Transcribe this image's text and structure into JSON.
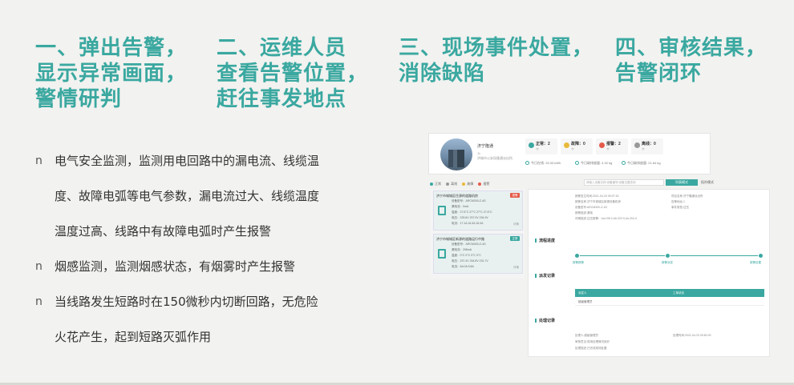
{
  "headings": [
    {
      "lines": [
        "一、弹出告警，",
        "显示异常画面，",
        "警情研判"
      ]
    },
    {
      "lines": [
        "二、运维人员",
        "查看告警位置，",
        "赶往事发地点"
      ]
    },
    {
      "lines": [
        "三、现场事件处置，",
        "消除缺陷"
      ]
    },
    {
      "lines": [
        "四、审核结果，",
        "告警闭环"
      ]
    }
  ],
  "bullet_mark": "n",
  "bullets": [
    {
      "lines": [
        "电气安全监测，监测用电回路中的漏电流、线缆温",
        "度、故障电弧等电气参数，漏电流过大、线缆温度",
        "温度过高、线路中有故障电弧时产生报警"
      ]
    },
    {
      "lines": [
        "烟感监测，监测烟感状态，有烟雾时产生报警"
      ]
    },
    {
      "lines": [
        "当线路发生短路时在150微秒内切断回路，无危险",
        "火花产生，起到短路灭弧作用"
      ]
    }
  ],
  "screenshot": {
    "place_name": "济宁隆通",
    "place_sub1": "11",
    "place_sub2": "济城市公安局隆通派出所",
    "stats": [
      {
        "label": "正常：2",
        "sub": "个",
        "color": "#3aa8a0"
      },
      {
        "label": "故障：0",
        "sub": "个",
        "color": "#e8b93a"
      },
      {
        "label": "报警：2",
        "sub": "个",
        "color": "#e55a4a"
      },
      {
        "label": "离线：0",
        "sub": "个",
        "color": "#999999"
      }
    ],
    "metrics": [
      "今日在线: 33.33 kWh",
      "今日碳排放量: 4.32 kg",
      "今日碳排放量: 21.64 kg"
    ],
    "legend": [
      {
        "label": "正常",
        "color": "#3aa8a0"
      },
      {
        "label": "离线",
        "color": "#999999"
      },
      {
        "label": "故障",
        "color": "#e8b93a"
      },
      {
        "label": "报警",
        "color": "#e55a4a"
      }
    ],
    "search_placeholder": "请输入设备名称/设备编号/设备位置查询",
    "list_btn": "列表模式",
    "map_btn": "拓扑模式",
    "devices": [
      {
        "title": "济宁市城城区住源的道路机房",
        "badge": "报警",
        "badge_color": "#e55a4a",
        "lines": [
          "设备型号：ARCM300-Z-4G",
          "漏电流：0mA",
          "温度：27.6°C  27°C  27°C  27.6°C",
          "电压：233.6V 237.9V 234.9V",
          "电流：17.1A 16.3A 16.0A"
        ],
        "detail": "详情"
      },
      {
        "title": "济宁市城城区新源的道路运行中路",
        "badge": "正常",
        "badge_color": "#3aa8a0",
        "lines": [
          "设备型号：ARCM300-Z-4G",
          "漏电流：298mA",
          "温度：0°C  0°C  0°C  0°C",
          "电压：237.4V 234.8V 231.7V",
          "电流：6A 0A 5.8A"
        ],
        "detail": "详情"
      }
    ],
    "info_lines": [
      "报警发生时间:2021-04-23 09:07:15",
      "报警名称:济宁市城城区新源设备机房",
      "设备型号:ARCM300-Z-4G",
      "报警描述:漏电",
      "详情描述:过压报警：Ua:195.2,Ub:222.9,Uc:204.4"
    ],
    "info_lines_right": [
      "项目名称:济宁隆通派出所",
      "告警地址:1",
      "事件类型:过压"
    ],
    "section_progress": "流程进度",
    "progress_nodes": [
      "报警报警",
      "报警派发",
      "报警处置"
    ],
    "section_dispatch": "派发记录",
    "table_headers": [
      "派发人",
      "工单状态"
    ],
    "table_row": "超级管理员",
    "section_handle": "处理记录",
    "handle_lines": [
      "处理人:超级管理员",
      "审核意见:现场处理情况良好",
      "处理描述:已完成现场处置"
    ],
    "handle_time": "处理时间:2021-04-23 09:50:29"
  }
}
